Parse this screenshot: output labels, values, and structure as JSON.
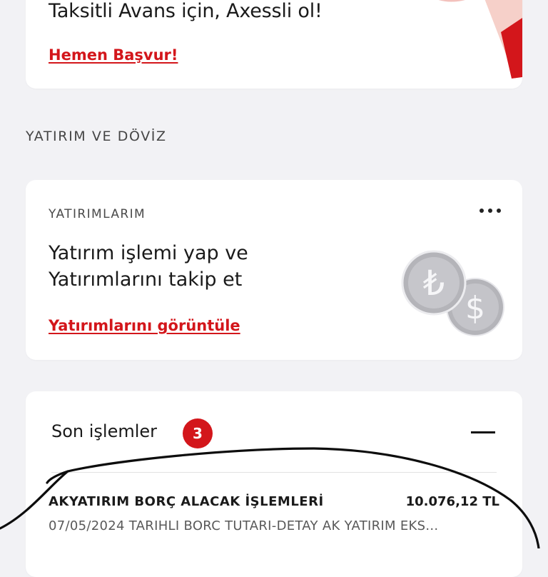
{
  "promo": {
    "title": "Taksitli Avans için, Axessli ol!",
    "link": "Hemen Başvur!"
  },
  "investment_section": {
    "header": "YATIRIM VE DÖVİZ",
    "card": {
      "eyebrow": "YATIRIMLARIM",
      "title_line1": "Yatırım işlemi yap ve",
      "title_line2": "Yatırımlarını takip et",
      "link": "Yatırımlarını görüntüle",
      "coin_symbols": [
        "₺",
        "$"
      ]
    }
  },
  "recent_transactions": {
    "title": "Son işlemler",
    "count": "3",
    "items": [
      {
        "name": "AKYATIRIM BORÇ ALACAK İŞLEMLERİ",
        "amount": "10.076,12 TL",
        "description": "07/05/2024 TARIHLI BORC TUTARI-DETAY AK YATIRIM EKS..."
      }
    ]
  },
  "colors": {
    "accent": "#d3161b",
    "background": "#f2f2f5",
    "card": "#ffffff",
    "coin": "#b8b8bd"
  },
  "icons": {
    "menu": "more-horizontal-icon",
    "collapse": "minus-icon"
  }
}
